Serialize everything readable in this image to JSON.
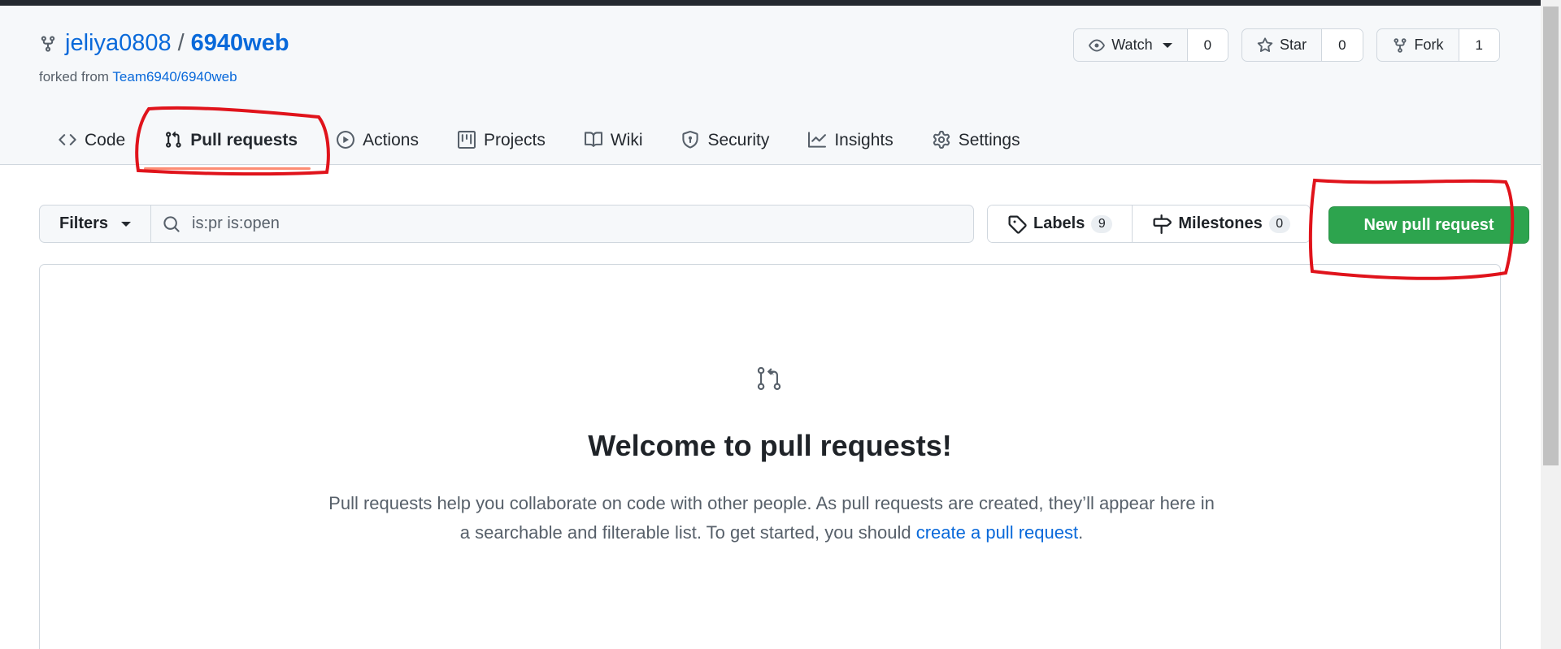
{
  "repo": {
    "owner": "jeliya0808",
    "separator": "/",
    "name": "6940web",
    "forked_from_prefix": "forked from",
    "forked_from_link": "Team6940/6940web"
  },
  "actions": {
    "watch": {
      "label": "Watch",
      "count": "0"
    },
    "star": {
      "label": "Star",
      "count": "0"
    },
    "fork": {
      "label": "Fork",
      "count": "1"
    }
  },
  "tabs": [
    {
      "label": "Code",
      "icon": "code-icon"
    },
    {
      "label": "Pull requests",
      "icon": "git-pull-request-icon",
      "active": true
    },
    {
      "label": "Actions",
      "icon": "play-icon"
    },
    {
      "label": "Projects",
      "icon": "table-icon"
    },
    {
      "label": "Wiki",
      "icon": "book-icon"
    },
    {
      "label": "Security",
      "icon": "shield-icon"
    },
    {
      "label": "Insights",
      "icon": "graph-icon"
    },
    {
      "label": "Settings",
      "icon": "gear-icon"
    }
  ],
  "toolbar": {
    "filters_label": "Filters",
    "search_value": "is:pr is:open",
    "labels_label": "Labels",
    "labels_count": "9",
    "milestones_label": "Milestones",
    "milestones_count": "0",
    "new_pr_label": "New pull request"
  },
  "blankslate": {
    "title": "Welcome to pull requests!",
    "text_before": "Pull requests help you collaborate on code with other people. As pull requests are created, they’ll appear here in a searchable and filterable list. To get started, you should ",
    "link_text": "create a pull request",
    "text_after": "."
  },
  "colors": {
    "accent": "#0969da",
    "primary_button": "#2da44e",
    "annotation": "#e0131b",
    "tab_underline": "#fd8c73"
  }
}
